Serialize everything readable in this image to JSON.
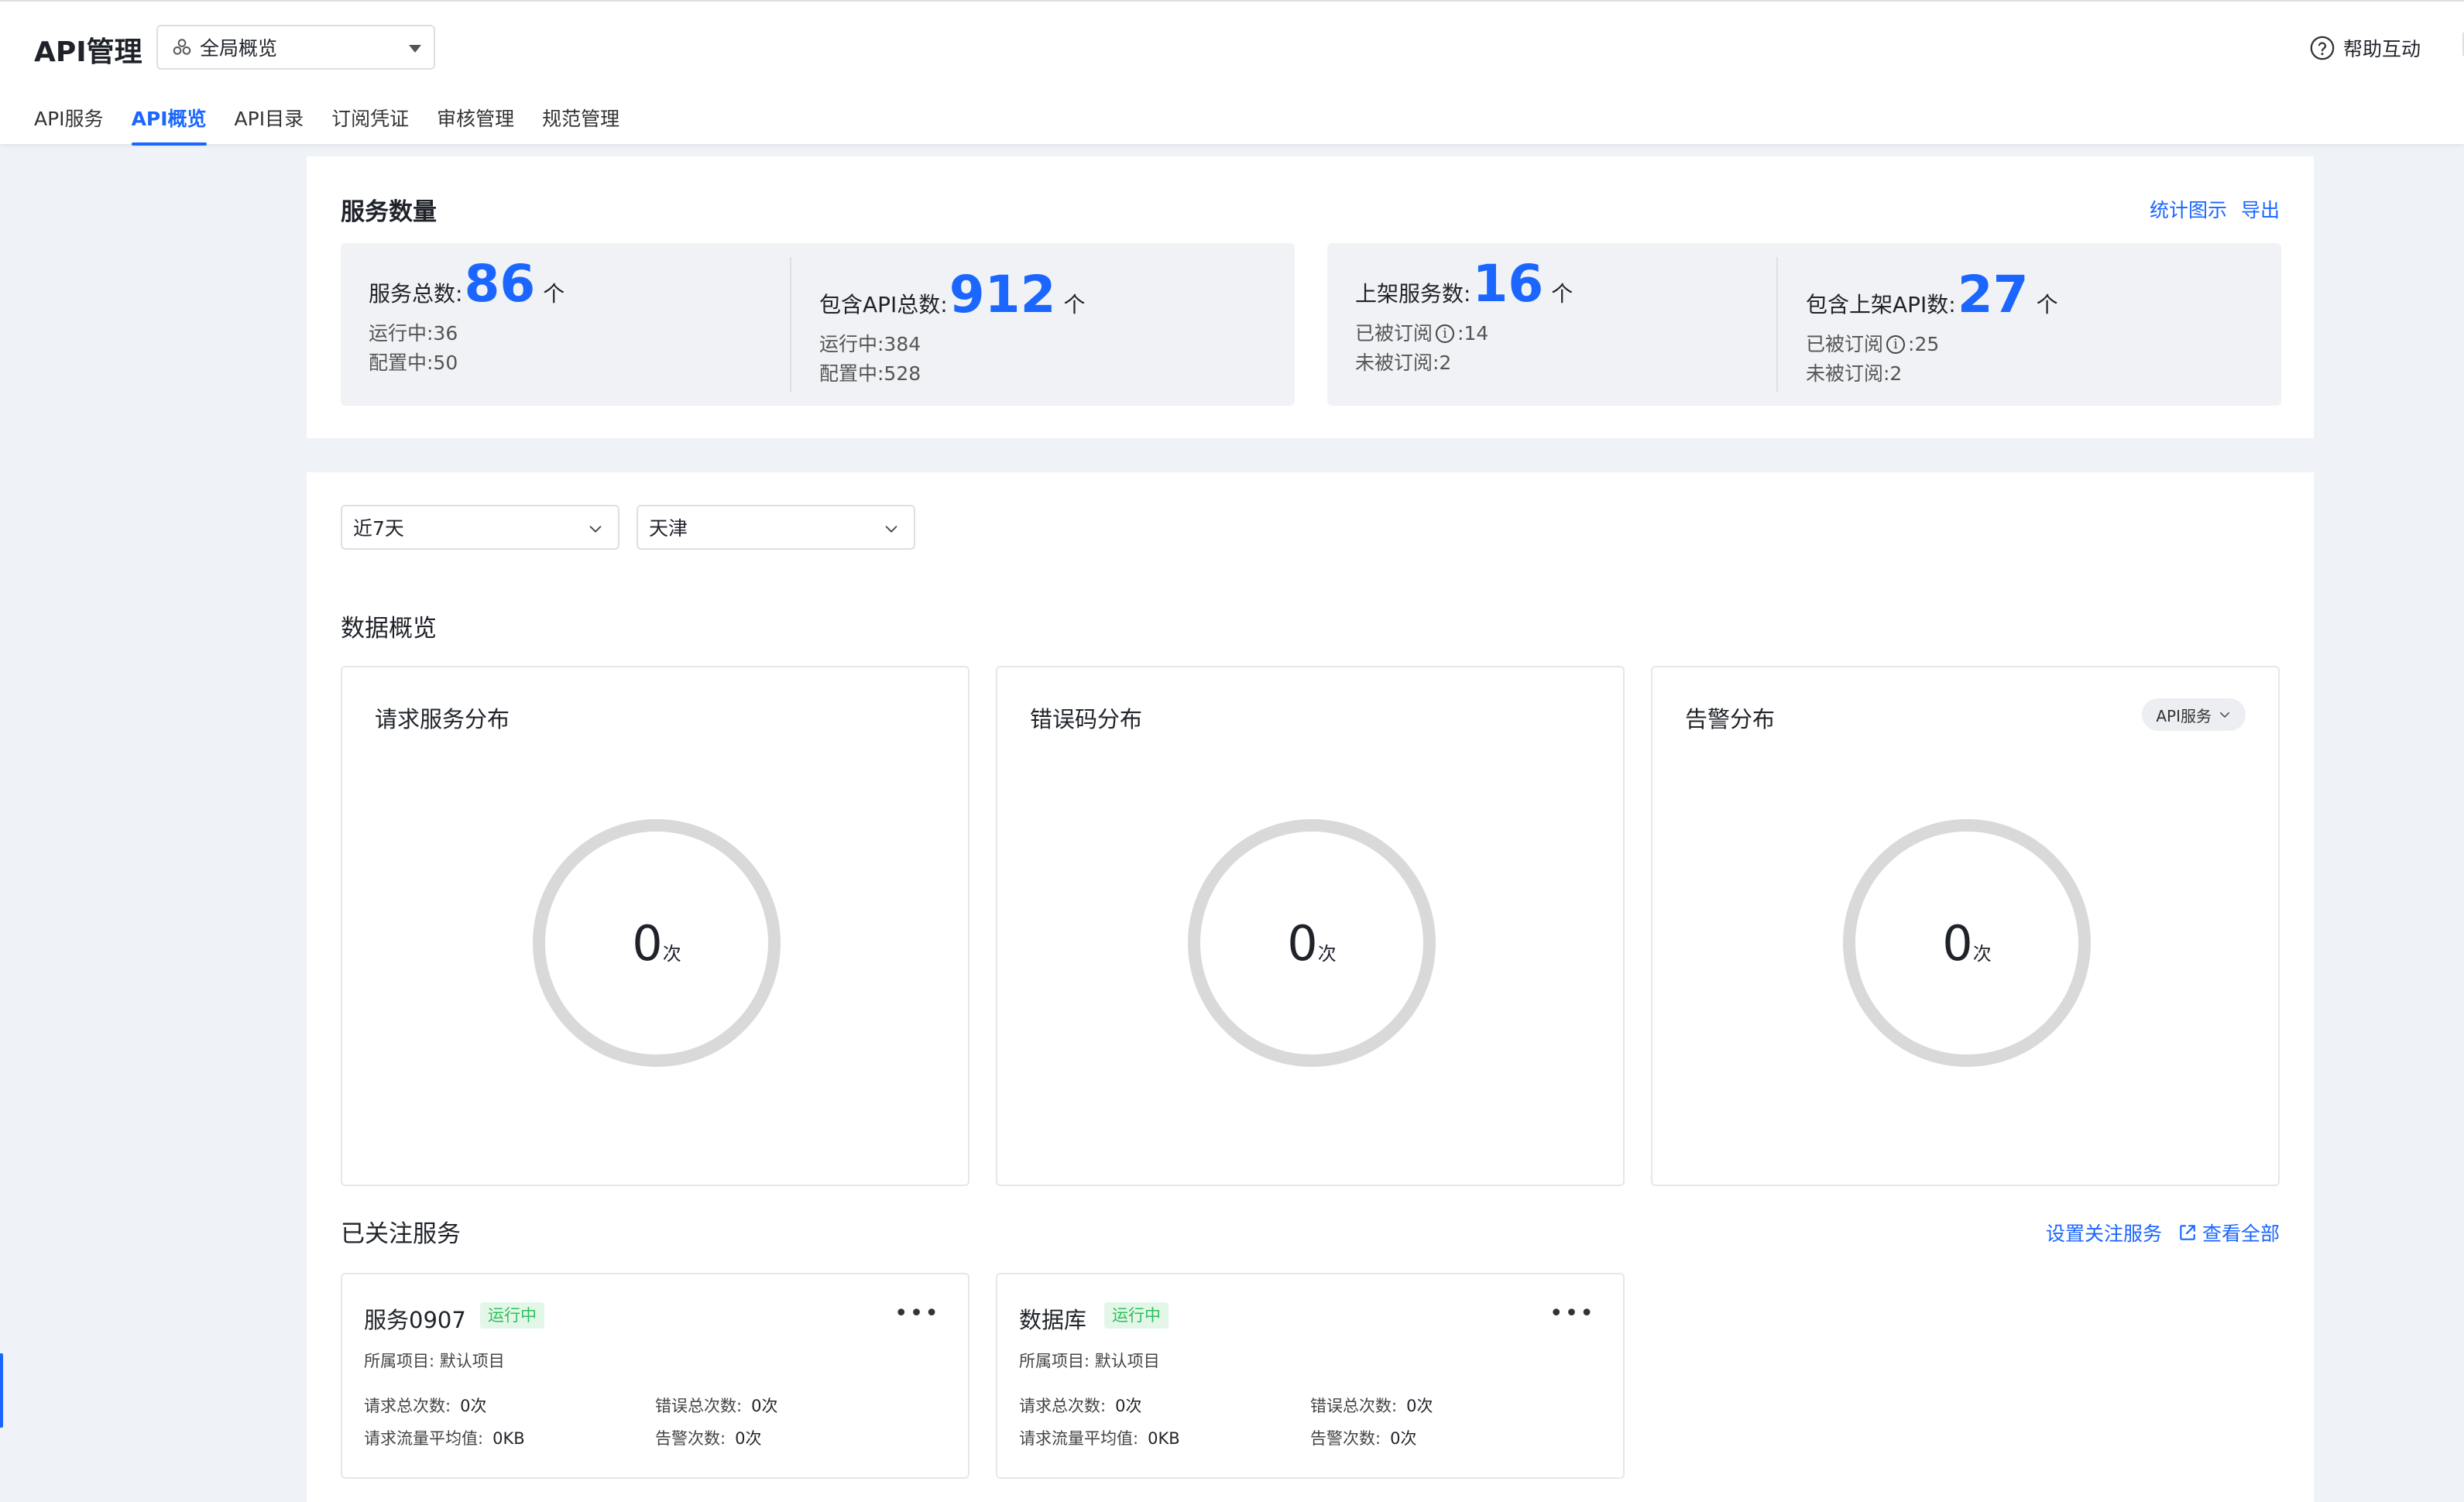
{
  "header": {
    "title": "API管理",
    "scope_select": {
      "value": "全局概览",
      "icon": "cluster-icon"
    },
    "help_label": "帮助互动",
    "tabs": [
      {
        "label": "API服务",
        "active": false
      },
      {
        "label": "API概览",
        "active": true
      },
      {
        "label": "API目录",
        "active": false
      },
      {
        "label": "订阅凭证",
        "active": false
      },
      {
        "label": "审核管理",
        "active": false
      },
      {
        "label": "规范管理",
        "active": false
      }
    ]
  },
  "service_count": {
    "title": "服务数量",
    "links": {
      "chart": "统计图示",
      "export": "导出"
    },
    "total_services": {
      "label": "服务总数:",
      "value": "86",
      "unit": "个",
      "running": "运行中:36",
      "configuring": "配置中:50"
    },
    "total_apis": {
      "label": "包含API总数:",
      "value": "912",
      "unit": "个",
      "running": "运行中:384",
      "configuring": "配置中:528"
    },
    "listed_services": {
      "label": "上架服务数:",
      "value": "16",
      "unit": "个",
      "subscribed_label": "已被订阅",
      "subscribed_value": ":14",
      "unsubscribed": "未被订阅:2"
    },
    "listed_apis": {
      "label": "包含上架API数:",
      "value": "27",
      "unit": "个",
      "subscribed_label": "已被订阅",
      "subscribed_value": ":25",
      "unsubscribed": "未被订阅:2"
    }
  },
  "filters": {
    "time": "近7天",
    "region": "天津"
  },
  "overview": {
    "title": "数据概览",
    "charts": [
      {
        "title": "请求服务分布",
        "value": "0",
        "unit": "次"
      },
      {
        "title": "错误码分布",
        "value": "0",
        "unit": "次"
      },
      {
        "title": "告警分布",
        "value": "0",
        "unit": "次",
        "badge": "API服务"
      }
    ]
  },
  "followed": {
    "title": "已关注服务",
    "set_link": "设置关注服务",
    "view_all": "查看全部",
    "services": [
      {
        "name": "服务0907",
        "status": "运行中",
        "project": "所属项目:  默认项目",
        "req_total_label": "请求总次数:",
        "req_total": "0次",
        "err_total_label": "错误总次数:",
        "err_total": "0次",
        "flow_avg_label": "请求流量平均值:",
        "flow_avg": "0KB",
        "alert_label": "告警次数:",
        "alert": "0次"
      },
      {
        "name": "数据库",
        "status": "运行中",
        "project": "所属项目:  默认项目",
        "req_total_label": "请求总次数:",
        "req_total": "0次",
        "err_total_label": "错误总次数:",
        "err_total": "0次",
        "flow_avg_label": "请求流量平均值:",
        "flow_avg": "0KB",
        "alert_label": "告警次数:",
        "alert": "0次"
      }
    ]
  },
  "colors": {
    "accent": "#1a66ff",
    "ring": "#d9d9d9",
    "status_green": "#2fbd5a"
  }
}
